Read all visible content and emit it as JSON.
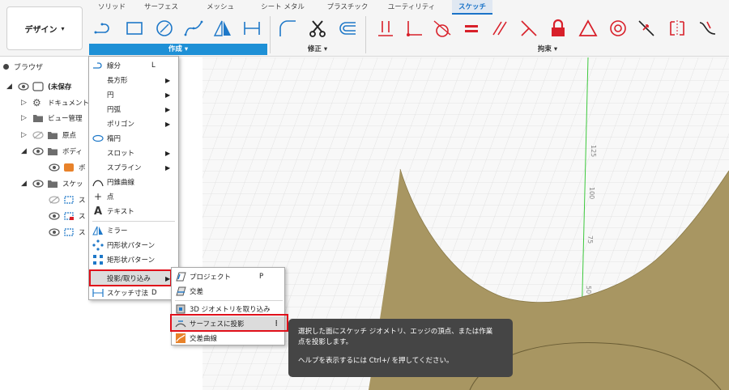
{
  "workspace": {
    "label": "デザイン",
    "caret": "▾"
  },
  "tabs": [
    {
      "label": "ソリッド"
    },
    {
      "label": "サーフェス"
    },
    {
      "label": "メッシュ"
    },
    {
      "label": "シート メタル"
    },
    {
      "label": "プラスチック"
    },
    {
      "label": "ユーティリティ"
    },
    {
      "label": "スケッチ",
      "active": true
    }
  ],
  "groups": {
    "create": "作成 ▾",
    "modify": "修正 ▾",
    "constraints": "拘束 ▾"
  },
  "accent_color": "#1e90d6",
  "highlight_border_color": "#e0101a",
  "browser": {
    "title": "ブラウザ",
    "items": [
      {
        "label": "(未保存",
        "icons": [
          "eye-icon",
          "component-icon"
        ]
      },
      {
        "label": "ドキュメント",
        "icons": [
          "gear-icon"
        ]
      },
      {
        "label": "ビュー管理",
        "icons": [
          "folder-icon"
        ]
      },
      {
        "label": "原点",
        "icons": [
          "eye-hidden-icon",
          "folder-icon"
        ]
      },
      {
        "label": "ボディ",
        "icons": [
          "eye-icon",
          "folder-icon"
        ]
      },
      {
        "label": "ボ",
        "icons": [
          "eye-icon",
          "body-icon"
        ]
      },
      {
        "label": "スケッ",
        "icons": [
          "eye-icon",
          "folder-icon"
        ]
      },
      {
        "label": "ス",
        "icons": [
          "eye-hidden-icon",
          "sketch-icon"
        ]
      },
      {
        "label": "ス",
        "icons": [
          "eye-icon",
          "sketch-locked-icon"
        ]
      },
      {
        "label": "ス",
        "icons": [
          "eye-icon",
          "sketch-icon"
        ]
      }
    ]
  },
  "create_menu": {
    "items": [
      {
        "label": "線分",
        "shortcut": "L",
        "icon": "line-icon"
      },
      {
        "label": "長方形",
        "submenu": true
      },
      {
        "label": "円",
        "submenu": true
      },
      {
        "label": "円弧",
        "submenu": true
      },
      {
        "label": "ポリゴン",
        "submenu": true
      },
      {
        "label": "楕円",
        "icon": "ellipse-icon"
      },
      {
        "label": "スロット",
        "submenu": true
      },
      {
        "label": "スプライン",
        "submenu": true
      },
      {
        "label": "円錐曲線",
        "icon": "conic-icon"
      },
      {
        "label": "点",
        "icon": "point-icon"
      },
      {
        "label": "テキスト",
        "icon": "text-icon"
      },
      {
        "label": "ミラー",
        "icon": "mirror-icon"
      },
      {
        "label": "円形状パターン",
        "icon": "circular-pattern-icon"
      },
      {
        "label": "矩形状パターン",
        "icon": "rectangular-pattern-icon"
      },
      {
        "label": "投影/取り込み",
        "submenu": true,
        "highlighted": true
      },
      {
        "label": "スケッチ寸法",
        "shortcut": "D",
        "icon": "dimension-icon"
      }
    ]
  },
  "project_menu": {
    "items": [
      {
        "label": "プロジェクト",
        "shortcut": "P",
        "icon": "project-icon"
      },
      {
        "label": "交差",
        "icon": "intersect-icon"
      },
      {
        "label": "3D ジオメトリを取り込み",
        "icon": "include-3d-icon"
      },
      {
        "label": "サーフェスに投影",
        "icon": "project-to-surface-icon",
        "highlighted": true,
        "more": "⋮"
      },
      {
        "label": "交差曲線",
        "icon": "intersection-curve-icon"
      }
    ]
  },
  "tooltip": {
    "line1": "選択した面にスケッチ ジオメトリ、エッジの頂点、または作業",
    "line2": "点を投影します。",
    "help": "ヘルプを表示するには Ctrl+/ を押してください。"
  },
  "canvas": {
    "axis_labels": [
      "125",
      "100",
      "75",
      "50"
    ],
    "surface_color": "#a89662",
    "grid_color": "#d9d9d9",
    "axis_color": "#3cc83c"
  }
}
